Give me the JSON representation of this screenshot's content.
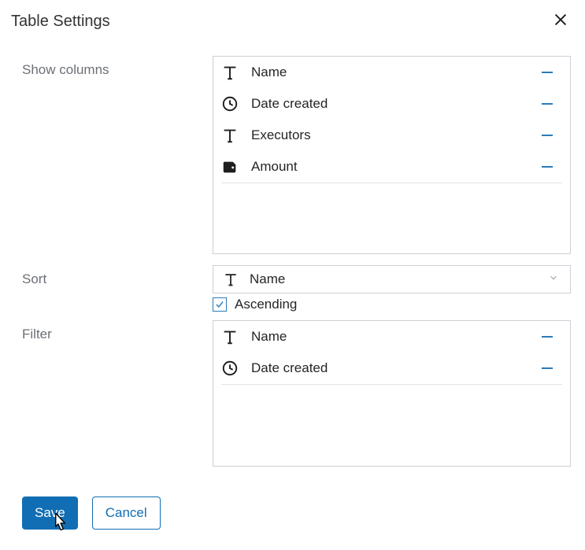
{
  "dialog": {
    "title": "Table Settings"
  },
  "labels": {
    "show_columns": "Show columns",
    "sort": "Sort",
    "filter": "Filter",
    "ascending": "Ascending"
  },
  "columns": [
    {
      "icon": "text",
      "label": "Name"
    },
    {
      "icon": "clock",
      "label": "Date created"
    },
    {
      "icon": "text",
      "label": "Executors"
    },
    {
      "icon": "wallet",
      "label": "Amount"
    }
  ],
  "sort": {
    "field_icon": "text",
    "field_label": "Name",
    "ascending": true
  },
  "filters": [
    {
      "icon": "text",
      "label": "Name"
    },
    {
      "icon": "clock",
      "label": "Date created"
    }
  ],
  "buttons": {
    "save": "Save",
    "cancel": "Cancel"
  }
}
